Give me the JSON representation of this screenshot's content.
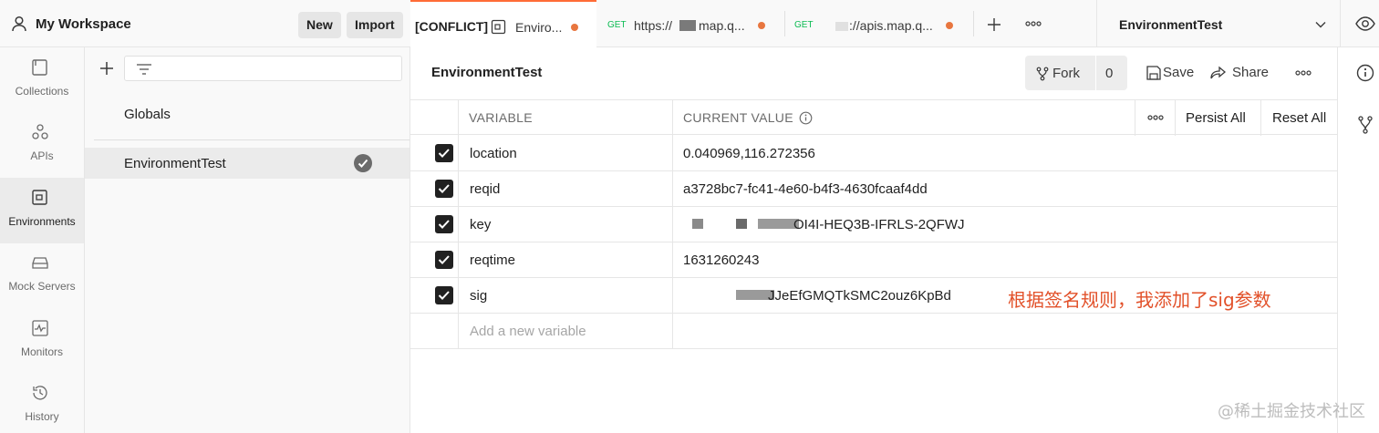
{
  "workspace": {
    "title": "My Workspace",
    "new_label": "New",
    "import_label": "Import"
  },
  "rail": {
    "items": [
      {
        "label": "Collections",
        "icon": "collections-icon"
      },
      {
        "label": "APIs",
        "icon": "apis-icon"
      },
      {
        "label": "Environments",
        "icon": "environments-icon",
        "active": true
      },
      {
        "label": "Mock Servers",
        "icon": "mock-servers-icon"
      },
      {
        "label": "Monitors",
        "icon": "monitors-icon"
      },
      {
        "label": "History",
        "icon": "history-icon"
      }
    ]
  },
  "sidebar": {
    "globals": "Globals",
    "environments": [
      {
        "name": "EnvironmentTest",
        "active": true
      }
    ]
  },
  "tabs": [
    {
      "prefix": "[CONFLICT]",
      "title": "Enviro...",
      "active": true
    },
    {
      "method": "GET",
      "title": "https://",
      "title_tail": "map.q..."
    },
    {
      "method": "GET",
      "title": "://apis.map.q..."
    }
  ],
  "environment_selector": "EnvironmentTest",
  "main": {
    "title": "EnvironmentTest",
    "fork_label": "Fork",
    "fork_count": "0",
    "save_label": "Save",
    "share_label": "Share"
  },
  "table": {
    "headers": {
      "variable": "VARIABLE",
      "current_value": "CURRENT VALUE",
      "persist_all": "Persist All",
      "reset_all": "Reset All"
    },
    "rows": [
      {
        "variable": "location",
        "value": "0.040969,116.272356",
        "checked": true
      },
      {
        "variable": "reqid",
        "value": "a3728bc7-fc41-4e60-b4f3-4630fcaaf4dd",
        "checked": true
      },
      {
        "variable": "key",
        "value": "OI4I-HEQ3B-IFRLS-2QFWJ",
        "checked": true
      },
      {
        "variable": "reqtime",
        "value": "1631260243",
        "checked": true
      },
      {
        "variable": "sig",
        "value": "JJeEfGMQTkSMC2ouz6KpBd",
        "checked": true
      }
    ],
    "add_placeholder": "Add a new variable"
  },
  "annotation": "根据签名规则，我添加了sig参数",
  "watermark": "@稀土掘金技术社区",
  "colors": {
    "accent": "#ff6c37",
    "dot": "#e8763f",
    "annotation": "#e2512a",
    "get": "#0cbb52"
  }
}
